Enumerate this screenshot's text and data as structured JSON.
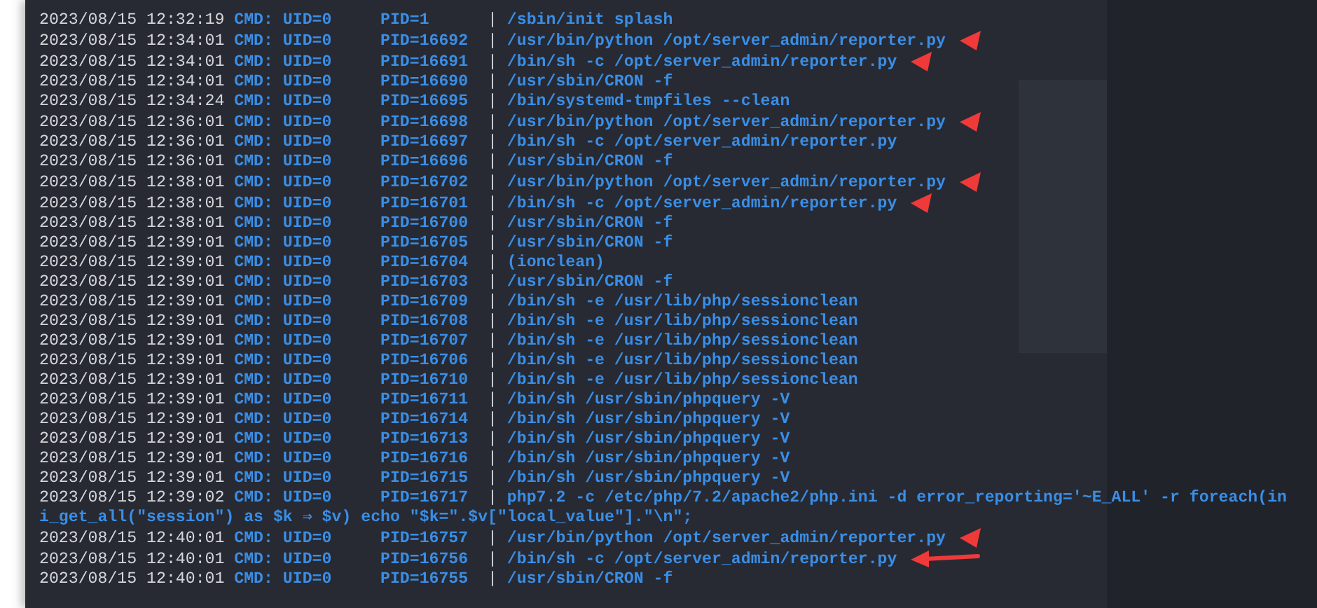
{
  "rows": [
    {
      "time": "2023/08/15 12:32:19",
      "tag": "CMD:",
      "uid": "UID=0",
      "pid": "PID=1",
      "sep": "|",
      "command": "/sbin/init splash",
      "marked": false
    },
    {
      "time": "2023/08/15 12:34:01",
      "tag": "CMD:",
      "uid": "UID=0",
      "pid": "PID=16692",
      "sep": "|",
      "command": "/usr/bin/python /opt/server_admin/reporter.py",
      "marked": true
    },
    {
      "time": "2023/08/15 12:34:01",
      "tag": "CMD:",
      "uid": "UID=0",
      "pid": "PID=16691",
      "sep": "|",
      "command": "/bin/sh -c /opt/server_admin/reporter.py",
      "marked": true
    },
    {
      "time": "2023/08/15 12:34:01",
      "tag": "CMD:",
      "uid": "UID=0",
      "pid": "PID=16690",
      "sep": "|",
      "command": "/usr/sbin/CRON -f",
      "marked": false
    },
    {
      "time": "2023/08/15 12:34:24",
      "tag": "CMD:",
      "uid": "UID=0",
      "pid": "PID=16695",
      "sep": "|",
      "command": "/bin/systemd-tmpfiles --clean",
      "marked": false
    },
    {
      "time": "2023/08/15 12:36:01",
      "tag": "CMD:",
      "uid": "UID=0",
      "pid": "PID=16698",
      "sep": "|",
      "command": "/usr/bin/python /opt/server_admin/reporter.py",
      "marked": true
    },
    {
      "time": "2023/08/15 12:36:01",
      "tag": "CMD:",
      "uid": "UID=0",
      "pid": "PID=16697",
      "sep": "|",
      "command": "/bin/sh -c /opt/server_admin/reporter.py",
      "marked": false
    },
    {
      "time": "2023/08/15 12:36:01",
      "tag": "CMD:",
      "uid": "UID=0",
      "pid": "PID=16696",
      "sep": "|",
      "command": "/usr/sbin/CRON -f",
      "marked": false
    },
    {
      "time": "2023/08/15 12:38:01",
      "tag": "CMD:",
      "uid": "UID=0",
      "pid": "PID=16702",
      "sep": "|",
      "command": "/usr/bin/python /opt/server_admin/reporter.py",
      "marked": true
    },
    {
      "time": "2023/08/15 12:38:01",
      "tag": "CMD:",
      "uid": "UID=0",
      "pid": "PID=16701",
      "sep": "|",
      "command": "/bin/sh -c /opt/server_admin/reporter.py",
      "marked": true
    },
    {
      "time": "2023/08/15 12:38:01",
      "tag": "CMD:",
      "uid": "UID=0",
      "pid": "PID=16700",
      "sep": "|",
      "command": "/usr/sbin/CRON -f",
      "marked": false
    },
    {
      "time": "2023/08/15 12:39:01",
      "tag": "CMD:",
      "uid": "UID=0",
      "pid": "PID=16705",
      "sep": "|",
      "command": "/usr/sbin/CRON -f",
      "marked": false
    },
    {
      "time": "2023/08/15 12:39:01",
      "tag": "CMD:",
      "uid": "UID=0",
      "pid": "PID=16704",
      "sep": "|",
      "command": "(ionclean)",
      "marked": false
    },
    {
      "time": "2023/08/15 12:39:01",
      "tag": "CMD:",
      "uid": "UID=0",
      "pid": "PID=16703",
      "sep": "|",
      "command": "/usr/sbin/CRON -f",
      "marked": false
    },
    {
      "time": "2023/08/15 12:39:01",
      "tag": "CMD:",
      "uid": "UID=0",
      "pid": "PID=16709",
      "sep": "|",
      "command": "/bin/sh -e /usr/lib/php/sessionclean",
      "marked": false
    },
    {
      "time": "2023/08/15 12:39:01",
      "tag": "CMD:",
      "uid": "UID=0",
      "pid": "PID=16708",
      "sep": "|",
      "command": "/bin/sh -e /usr/lib/php/sessionclean",
      "marked": false
    },
    {
      "time": "2023/08/15 12:39:01",
      "tag": "CMD:",
      "uid": "UID=0",
      "pid": "PID=16707",
      "sep": "|",
      "command": "/bin/sh -e /usr/lib/php/sessionclean",
      "marked": false
    },
    {
      "time": "2023/08/15 12:39:01",
      "tag": "CMD:",
      "uid": "UID=0",
      "pid": "PID=16706",
      "sep": "|",
      "command": "/bin/sh -e /usr/lib/php/sessionclean",
      "marked": false
    },
    {
      "time": "2023/08/15 12:39:01",
      "tag": "CMD:",
      "uid": "UID=0",
      "pid": "PID=16710",
      "sep": "|",
      "command": "/bin/sh -e /usr/lib/php/sessionclean",
      "marked": false
    },
    {
      "time": "2023/08/15 12:39:01",
      "tag": "CMD:",
      "uid": "UID=0",
      "pid": "PID=16711",
      "sep": "|",
      "command": "/bin/sh /usr/sbin/phpquery -V",
      "marked": false
    },
    {
      "time": "2023/08/15 12:39:01",
      "tag": "CMD:",
      "uid": "UID=0",
      "pid": "PID=16714",
      "sep": "|",
      "command": "/bin/sh /usr/sbin/phpquery -V",
      "marked": false
    },
    {
      "time": "2023/08/15 12:39:01",
      "tag": "CMD:",
      "uid": "UID=0",
      "pid": "PID=16713",
      "sep": "|",
      "command": "/bin/sh /usr/sbin/phpquery -V",
      "marked": false
    },
    {
      "time": "2023/08/15 12:39:01",
      "tag": "CMD:",
      "uid": "UID=0",
      "pid": "PID=16716",
      "sep": "|",
      "command": "/bin/sh /usr/sbin/phpquery -V",
      "marked": false
    },
    {
      "time": "2023/08/15 12:39:01",
      "tag": "CMD:",
      "uid": "UID=0",
      "pid": "PID=16715",
      "sep": "|",
      "command": "/bin/sh /usr/sbin/phpquery -V",
      "marked": false
    },
    {
      "time": "2023/08/15 12:39:02",
      "tag": "CMD:",
      "uid": "UID=0",
      "pid": "PID=16717",
      "sep": "|",
      "command": "php7.2 -c /etc/php/7.2/apache2/php.ini -d error_reporting='~E_ALL' -r foreach(in",
      "continuation": "i_get_all(\"session\") as $k ⇒ $v) echo \"$k=\".$v[\"local_value\"].\"\\n\";",
      "marked": false
    },
    {
      "time": "2023/08/15 12:40:01",
      "tag": "CMD:",
      "uid": "UID=0",
      "pid": "PID=16757",
      "sep": "|",
      "command": "/usr/bin/python /opt/server_admin/reporter.py",
      "marked": true
    },
    {
      "time": "2023/08/15 12:40:01",
      "tag": "CMD:",
      "uid": "UID=0",
      "pid": "PID=16756",
      "sep": "|",
      "command": "/bin/sh -c /opt/server_admin/reporter.py",
      "marked": true,
      "long_arrow": true
    },
    {
      "time": "2023/08/15 12:40:01",
      "tag": "CMD:",
      "uid": "UID=0",
      "pid": "PID=16755",
      "sep": "|",
      "command": "/usr/sbin/CRON -f",
      "marked": false
    }
  ]
}
